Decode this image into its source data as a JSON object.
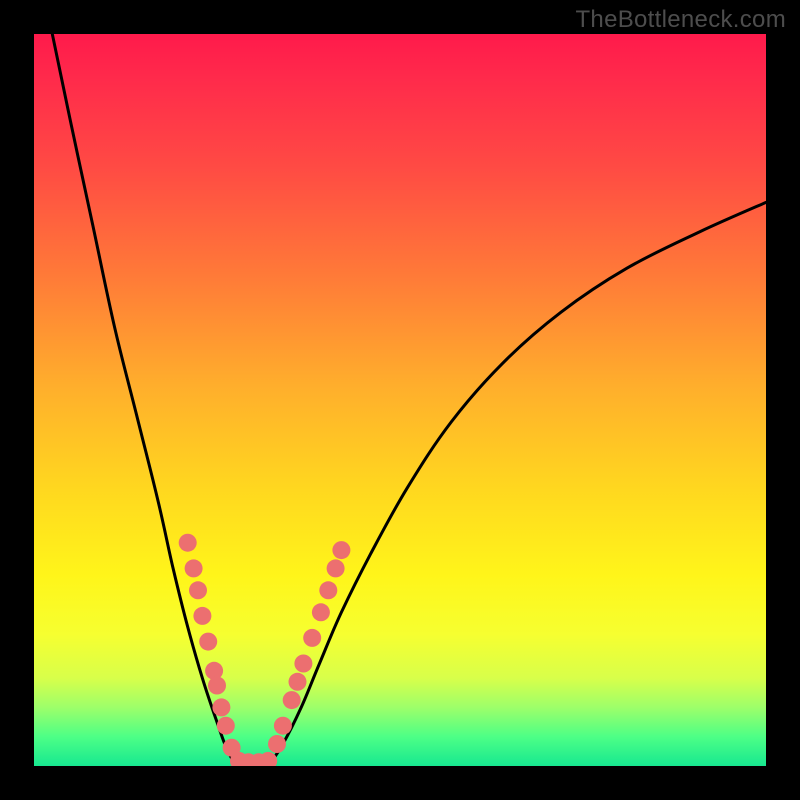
{
  "watermark": "TheBottleneck.com",
  "chart_data": {
    "type": "line",
    "title": "",
    "xlabel": "",
    "ylabel": "",
    "xlim": [
      0,
      100
    ],
    "ylim": [
      0,
      100
    ],
    "gradient_stops": [
      {
        "pct": 0,
        "color": "#ff1a4b"
      },
      {
        "pct": 6,
        "color": "#ff2a4b"
      },
      {
        "pct": 18,
        "color": "#ff4a44"
      },
      {
        "pct": 33,
        "color": "#ff7a38"
      },
      {
        "pct": 48,
        "color": "#ffae2c"
      },
      {
        "pct": 62,
        "color": "#ffd71f"
      },
      {
        "pct": 74,
        "color": "#fff51a"
      },
      {
        "pct": 82,
        "color": "#f6ff30"
      },
      {
        "pct": 88,
        "color": "#d8ff4a"
      },
      {
        "pct": 92,
        "color": "#9dff6a"
      },
      {
        "pct": 96,
        "color": "#4dff86"
      },
      {
        "pct": 100,
        "color": "#17e890"
      }
    ],
    "series": [
      {
        "name": "v-curve-left",
        "x": [
          2.5,
          5,
          8,
          11,
          14,
          17,
          19,
          21,
          23,
          25,
          26.5,
          28
        ],
        "y": [
          100,
          88,
          74,
          60,
          48,
          36,
          27,
          19,
          12,
          6,
          2,
          0
        ]
      },
      {
        "name": "v-curve-right",
        "x": [
          32,
          34,
          36.5,
          39,
          42,
          46,
          51,
          57,
          64,
          72,
          81,
          91,
          100
        ],
        "y": [
          0,
          3,
          8,
          14,
          21,
          29,
          38,
          47,
          55,
          62,
          68,
          73,
          77
        ]
      },
      {
        "name": "v-curve-floor",
        "x": [
          28,
          30,
          32
        ],
        "y": [
          0,
          0,
          0
        ]
      }
    ],
    "markers": {
      "name": "highlight-dots",
      "color": "#ec6f70",
      "radius_px": 9,
      "points": [
        {
          "x": 21.0,
          "y": 30.5
        },
        {
          "x": 21.8,
          "y": 27.0
        },
        {
          "x": 22.4,
          "y": 24.0
        },
        {
          "x": 23.0,
          "y": 20.5
        },
        {
          "x": 23.8,
          "y": 17.0
        },
        {
          "x": 24.6,
          "y": 13.0
        },
        {
          "x": 25.0,
          "y": 11.0
        },
        {
          "x": 25.6,
          "y": 8.0
        },
        {
          "x": 26.2,
          "y": 5.5
        },
        {
          "x": 27.0,
          "y": 2.5
        },
        {
          "x": 28.0,
          "y": 0.7
        },
        {
          "x": 29.3,
          "y": 0.5
        },
        {
          "x": 30.7,
          "y": 0.5
        },
        {
          "x": 32.0,
          "y": 0.7
        },
        {
          "x": 33.2,
          "y": 3.0
        },
        {
          "x": 34.0,
          "y": 5.5
        },
        {
          "x": 35.2,
          "y": 9.0
        },
        {
          "x": 36.0,
          "y": 11.5
        },
        {
          "x": 36.8,
          "y": 14.0
        },
        {
          "x": 38.0,
          "y": 17.5
        },
        {
          "x": 39.2,
          "y": 21.0
        },
        {
          "x": 40.2,
          "y": 24.0
        },
        {
          "x": 41.2,
          "y": 27.0
        },
        {
          "x": 42.0,
          "y": 29.5
        }
      ]
    }
  }
}
